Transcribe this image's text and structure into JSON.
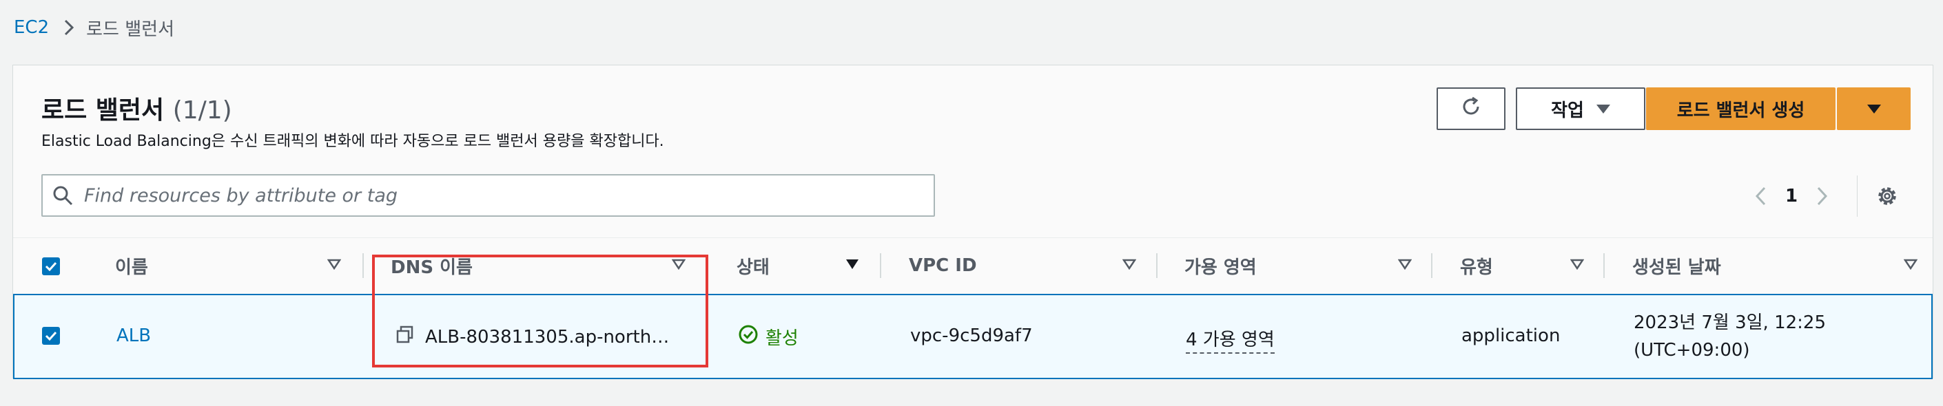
{
  "breadcrumb": {
    "root": "EC2",
    "current": "로드 밸런서"
  },
  "header": {
    "title": "로드 밸런서",
    "count": "(1/1)",
    "description": "Elastic Load Balancing은 수신 트래픽의 변화에 따라 자동으로 로드 밸런서 용량을 확장합니다."
  },
  "toolbar": {
    "refresh_icon": "refresh-icon",
    "actions_label": "작업",
    "create_label": "로드 밸런서 생성"
  },
  "search": {
    "placeholder": "Find resources by attribute or tag",
    "value": ""
  },
  "pagination": {
    "current_page": "1"
  },
  "table": {
    "columns": [
      "이름",
      "DNS 이름",
      "상태",
      "VPC ID",
      "가용 영역",
      "유형",
      "생성된 날짜"
    ],
    "rows": [
      {
        "selected": true,
        "name": "ALB",
        "dns": "ALB-803811305.ap-north…",
        "status": "활성",
        "vpc": "vpc-9c5d9af7",
        "az": "4 가용 영역",
        "type": "application",
        "created_line1": "2023년 7월 3일, 12:25",
        "created_line2": "(UTC+09:00)"
      }
    ]
  },
  "colors": {
    "accent": "#0073bb",
    "primary_button": "#ec9b33",
    "status_active": "#1d8102",
    "highlight": "#e53935"
  }
}
